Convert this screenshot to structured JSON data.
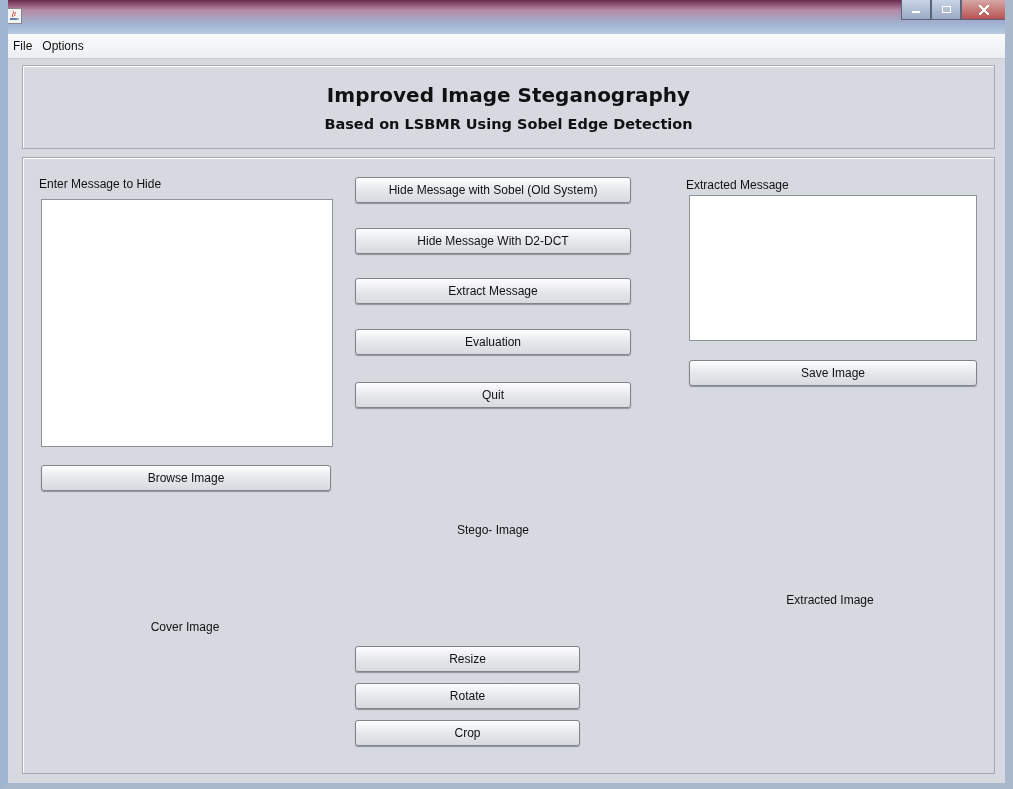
{
  "menu_bar": [
    "File",
    "Options"
  ],
  "header": {
    "title": "Improved Image Steganography",
    "subtitle": "Based on LSBMR Using Sobel Edge Detection"
  },
  "left": {
    "label": "Enter Message to Hide",
    "browse_button": "Browse Image",
    "cover_label": "Cover Image"
  },
  "center": {
    "actions": [
      "Hide Message with Sobel (Old System)",
      "Hide Message With D2-DCT",
      "Extract Message",
      "Evaluation",
      "Quit"
    ],
    "stego_label": "Stego- Image",
    "tools": [
      "Resize",
      "Rotate",
      "Crop"
    ]
  },
  "right": {
    "label": "Extracted Message",
    "save_button": "Save Image",
    "extracted_label": "Extracted Image"
  }
}
